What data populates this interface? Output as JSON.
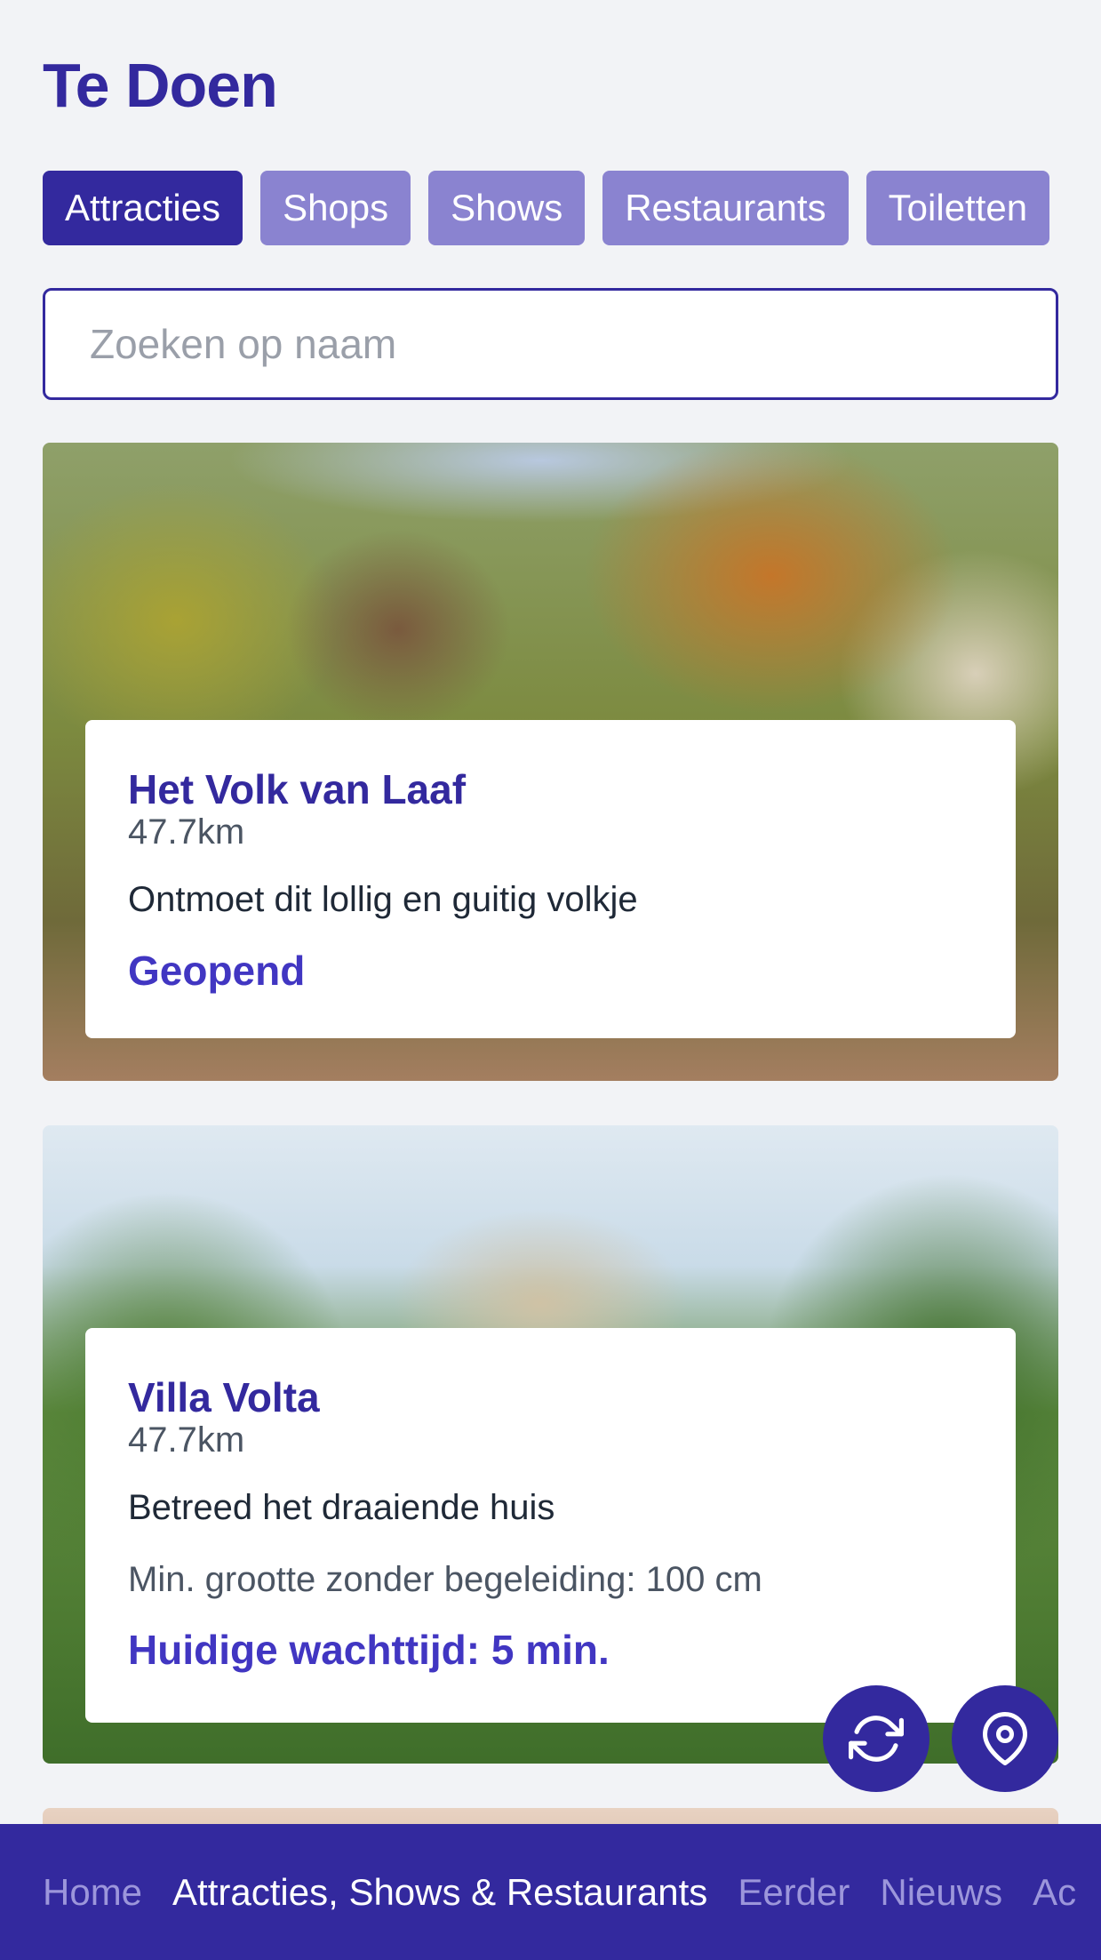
{
  "page": {
    "title": "Te Doen"
  },
  "tabs": [
    {
      "label": "Attracties",
      "active": true
    },
    {
      "label": "Shops",
      "active": false
    },
    {
      "label": "Shows",
      "active": false
    },
    {
      "label": "Restaurants",
      "active": false
    },
    {
      "label": "Toiletten",
      "active": false
    }
  ],
  "search": {
    "placeholder": "Zoeken op naam",
    "value": ""
  },
  "cards": [
    {
      "name": "Het Volk van Laaf",
      "distance": "47.7km",
      "description": "Ontmoet dit lollig en guitig volkje",
      "status": "Geopend"
    },
    {
      "name": "Villa Volta",
      "distance": "47.7km",
      "description": "Betreed het draaiende huis",
      "min_height": "Min. grootte zonder begeleiding: 100 cm",
      "status": "Huidige wachttijd: 5 min."
    }
  ],
  "fabs": {
    "refresh_icon": "refresh-icon",
    "location_icon": "location-pin-icon"
  },
  "bottom_nav": [
    {
      "label": "Home",
      "active": false
    },
    {
      "label": "Attracties, Shows & Restaurants",
      "active": true
    },
    {
      "label": "Eerder",
      "active": false
    },
    {
      "label": "Nieuws",
      "active": false
    },
    {
      "label": "Ac",
      "active": false
    }
  ],
  "colors": {
    "brand": "#33299e",
    "tab_inactive": "#8a83d0",
    "status": "#4136c2",
    "background": "#f2f3f6"
  }
}
